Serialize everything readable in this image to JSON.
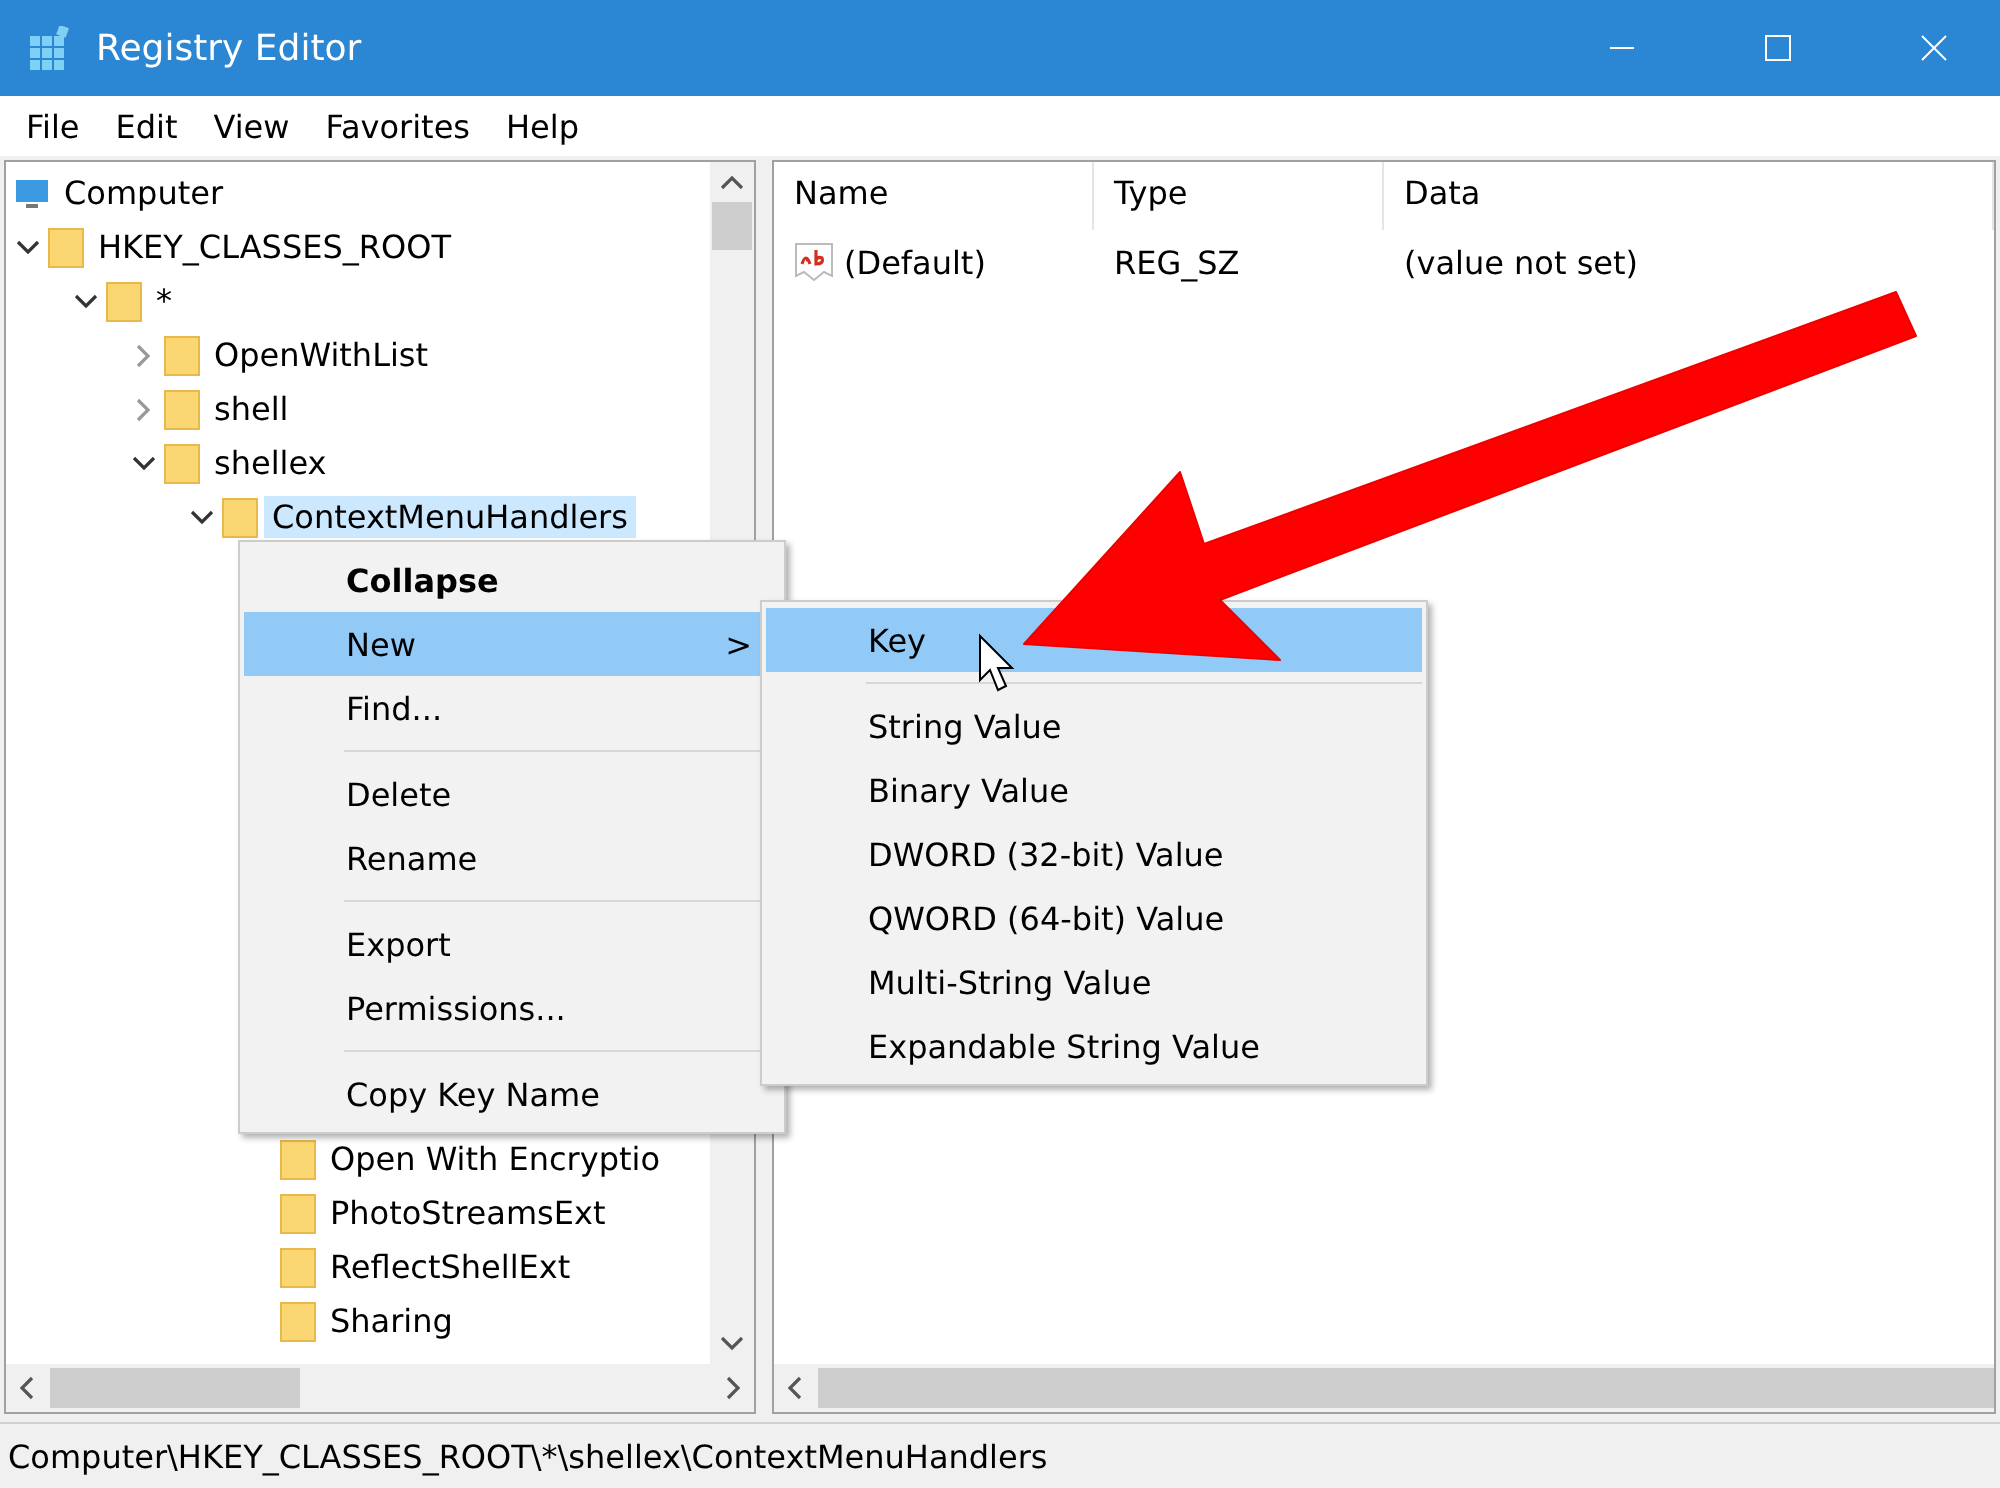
{
  "window": {
    "title": "Registry Editor"
  },
  "menu_bar": [
    "File",
    "Edit",
    "View",
    "Favorites",
    "Help"
  ],
  "tree": [
    {
      "label": "Computer",
      "kind": "computer",
      "selected": false,
      "children": [
        {
          "label": "HKEY_CLASSES_ROOT",
          "kind": "folder",
          "expanded": true,
          "selected": false,
          "children": [
            {
              "label": "*",
              "kind": "folder",
              "expanded": true,
              "selected": false,
              "children": [
                {
                  "label": "OpenWithList",
                  "kind": "folder",
                  "expanded": false,
                  "selected": false
                },
                {
                  "label": "shell",
                  "kind": "folder",
                  "expanded": false,
                  "selected": false
                },
                {
                  "label": "shellex",
                  "kind": "folder",
                  "expanded": true,
                  "selected": false,
                  "children": [
                    {
                      "label": "ContextMenuHandlers",
                      "kind": "folder",
                      "expanded": true,
                      "selected": true,
                      "children": [
                        {
                          "label": "Open With Encryptio",
                          "kind": "folder",
                          "selected": false
                        },
                        {
                          "label": "PhotoStreamsExt",
                          "kind": "folder",
                          "selected": false
                        },
                        {
                          "label": "ReflectShellExt",
                          "kind": "folder",
                          "selected": false
                        },
                        {
                          "label": "Sharing",
                          "kind": "folder",
                          "selected": false
                        }
                      ]
                    }
                  ]
                }
              ]
            }
          ]
        }
      ]
    }
  ],
  "values_table": {
    "columns": [
      "Name",
      "Type",
      "Data"
    ],
    "rows": [
      {
        "name": "(Default)",
        "type": "REG_SZ",
        "data": "(value not set)"
      }
    ]
  },
  "context_menu": {
    "items": [
      {
        "kind": "item",
        "label": "Collapse",
        "bold": true,
        "selected": false
      },
      {
        "kind": "item",
        "label": "New",
        "bold": false,
        "selected": true,
        "arrow": ">"
      },
      {
        "kind": "item",
        "label": "Find...",
        "bold": false,
        "selected": false
      },
      {
        "kind": "separator"
      },
      {
        "kind": "item",
        "label": "Delete",
        "bold": false,
        "selected": false
      },
      {
        "kind": "item",
        "label": "Rename",
        "bold": false,
        "selected": false
      },
      {
        "kind": "separator"
      },
      {
        "kind": "item",
        "label": "Export",
        "bold": false,
        "selected": false
      },
      {
        "kind": "item",
        "label": "Permissions...",
        "bold": false,
        "selected": false
      },
      {
        "kind": "separator"
      },
      {
        "kind": "item",
        "label": "Copy Key Name",
        "bold": false,
        "selected": false
      }
    ]
  },
  "submenu": {
    "items": [
      {
        "kind": "item",
        "label": "Key",
        "selected": true
      },
      {
        "kind": "separator"
      },
      {
        "kind": "item",
        "label": "String Value",
        "selected": false
      },
      {
        "kind": "item",
        "label": "Binary Value",
        "selected": false
      },
      {
        "kind": "item",
        "label": "DWORD (32-bit) Value",
        "selected": false
      },
      {
        "kind": "item",
        "label": "QWORD (64-bit) Value",
        "selected": false
      },
      {
        "kind": "item",
        "label": "Multi-String Value",
        "selected": false
      },
      {
        "kind": "item",
        "label": "Expandable String Value",
        "selected": false
      }
    ]
  },
  "status_bar": "Computer\\HKEY_CLASSES_ROOT\\*\\shellex\\ContextMenuHandlers"
}
